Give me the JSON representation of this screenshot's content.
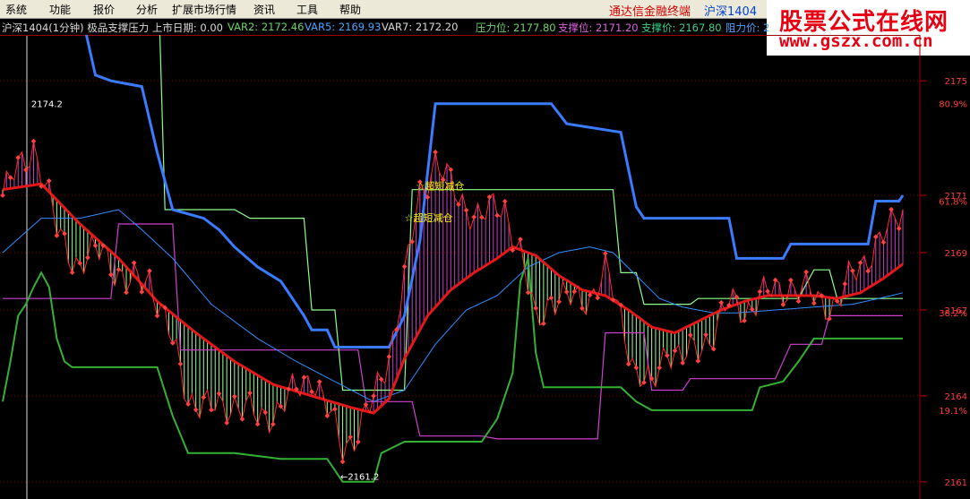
{
  "menu": [
    "系统",
    "功能",
    "报价",
    "分析",
    "扩展市场行情",
    "资讯",
    "工具",
    "帮助"
  ],
  "app_title": "通达信金融终端",
  "app_code": "沪深1404",
  "logo": {
    "line1": "股票公式在线网",
    "line2": "www.gszx.com.cn"
  },
  "info": {
    "title": "沪深1404(1分钟) 极品支撑压力 上市日期: 0.00",
    "var2": "VAR2: 2172.46",
    "var5": "VAR5: 2169.93",
    "var7": "VAR7: 2172.20",
    "pressure": "压力位: 2177.80",
    "support": "支撑位: 2171.20",
    "support_price": "支撑价: 2167.80",
    "resist_price": "阻力价: 2"
  },
  "colors": {
    "price": "#ff2a2a",
    "ma": "#e31818",
    "var5": "#2f8fff",
    "upper": "#3a7bff",
    "lower": "#35b035",
    "support": "#d040d0",
    "pressure": "#8cff8c",
    "bull_fill": "#c040c0",
    "bear_fill": "#9dff9d"
  },
  "chart_data": {
    "type": "line",
    "ylim": [
      2160.4,
      2176.6
    ],
    "y_ticks": [
      2175,
      2171,
      2169,
      2167,
      2164,
      2161
    ],
    "pct_ticks": [
      {
        "value": 2174.2,
        "label": "80.9%"
      },
      {
        "value": 2170.8,
        "label": "61.8%"
      },
      {
        "value": 2166.9,
        "label": "38.2%"
      },
      {
        "value": 2163.5,
        "label": "19.1%"
      }
    ],
    "annotations": [
      {
        "label": "2174.2",
        "x": 6,
        "y": 2174.2
      },
      {
        "label": "←2161.2",
        "x": 86,
        "y": 2161.2
      }
    ],
    "signals": [
      {
        "label": "☆超短减仓",
        "x": 107,
        "y": 2171.2
      },
      {
        "label": "☆超短减仓",
        "x": 104,
        "y": 2170.1
      }
    ],
    "n": 234,
    "series": [
      {
        "key": "close",
        "points": [
          [
            0,
            2171.0
          ],
          [
            8,
            2172.8
          ],
          [
            14,
            2169.8
          ],
          [
            20,
            2168.5
          ],
          [
            26,
            2169.2
          ],
          [
            32,
            2167.8
          ],
          [
            38,
            2168.2
          ],
          [
            44,
            2165.8
          ],
          [
            48,
            2164.0
          ],
          [
            54,
            2163.5
          ],
          [
            60,
            2163.8
          ],
          [
            66,
            2163.2
          ],
          [
            72,
            2163.6
          ],
          [
            76,
            2164.2
          ],
          [
            80,
            2164.8
          ],
          [
            84,
            2163.5
          ],
          [
            88,
            2162.2
          ],
          [
            92,
            2162.8
          ],
          [
            96,
            2163.8
          ],
          [
            100,
            2165.5
          ],
          [
            104,
            2168.0
          ],
          [
            108,
            2171.0
          ],
          [
            112,
            2172.3
          ],
          [
            118,
            2170.8
          ],
          [
            124,
            2170.3
          ],
          [
            130,
            2170.6
          ],
          [
            134,
            2169.0
          ],
          [
            138,
            2166.5
          ],
          [
            142,
            2167.5
          ],
          [
            148,
            2167.3
          ],
          [
            152,
            2167.5
          ],
          [
            156,
            2168.3
          ],
          [
            160,
            2166.8
          ],
          [
            164,
            2164.8
          ],
          [
            168,
            2164.2
          ],
          [
            172,
            2165.8
          ],
          [
            176,
            2165.3
          ],
          [
            180,
            2165.6
          ],
          [
            184,
            2166.3
          ],
          [
            188,
            2167.2
          ],
          [
            192,
            2167.0
          ],
          [
            196,
            2167.5
          ],
          [
            200,
            2167.6
          ],
          [
            204,
            2167.9
          ],
          [
            208,
            2167.6
          ],
          [
            212,
            2167.3
          ],
          [
            216,
            2167.2
          ],
          [
            220,
            2168.2
          ],
          [
            226,
            2169.3
          ],
          [
            230,
            2169.8
          ],
          [
            233,
            2170.6
          ]
        ]
      },
      {
        "key": "ma",
        "points": [
          [
            0,
            2171.2
          ],
          [
            10,
            2171.4
          ],
          [
            20,
            2170.0
          ],
          [
            30,
            2168.8
          ],
          [
            40,
            2167.3
          ],
          [
            50,
            2166.2
          ],
          [
            60,
            2165.2
          ],
          [
            70,
            2164.4
          ],
          [
            80,
            2164.0
          ],
          [
            90,
            2163.6
          ],
          [
            96,
            2163.4
          ],
          [
            100,
            2163.9
          ],
          [
            104,
            2165.3
          ],
          [
            110,
            2166.8
          ],
          [
            116,
            2167.7
          ],
          [
            122,
            2168.3
          ],
          [
            128,
            2168.8
          ],
          [
            132,
            2169.2
          ],
          [
            138,
            2168.9
          ],
          [
            144,
            2168.2
          ],
          [
            150,
            2167.7
          ],
          [
            156,
            2167.5
          ],
          [
            162,
            2167.0
          ],
          [
            168,
            2166.4
          ],
          [
            174,
            2166.2
          ],
          [
            180,
            2166.6
          ],
          [
            186,
            2167.0
          ],
          [
            192,
            2167.3
          ],
          [
            198,
            2167.5
          ],
          [
            204,
            2167.5
          ],
          [
            210,
            2167.5
          ],
          [
            216,
            2167.4
          ],
          [
            222,
            2167.6
          ],
          [
            228,
            2168.1
          ],
          [
            233,
            2168.6
          ]
        ]
      },
      {
        "key": "var5",
        "points": [
          [
            0,
            2169.0
          ],
          [
            10,
            2170.2
          ],
          [
            20,
            2170.2
          ],
          [
            30,
            2170.5
          ],
          [
            36,
            2169.8
          ],
          [
            44,
            2168.8
          ],
          [
            54,
            2167.2
          ],
          [
            66,
            2166.0
          ],
          [
            76,
            2165.2
          ],
          [
            86,
            2164.5
          ],
          [
            96,
            2163.8
          ],
          [
            104,
            2164.2
          ],
          [
            112,
            2165.8
          ],
          [
            120,
            2167.0
          ],
          [
            128,
            2167.5
          ],
          [
            136,
            2168.5
          ],
          [
            144,
            2169.0
          ],
          [
            152,
            2169.2
          ],
          [
            158,
            2169.0
          ],
          [
            164,
            2168.2
          ],
          [
            170,
            2167.4
          ],
          [
            176,
            2167.1
          ],
          [
            184,
            2166.9
          ],
          [
            190,
            2166.9
          ],
          [
            200,
            2167.0
          ],
          [
            210,
            2167.1
          ],
          [
            220,
            2167.2
          ],
          [
            230,
            2167.5
          ],
          [
            233,
            2167.6
          ]
        ]
      },
      {
        "key": "upper",
        "points": [
          [
            0,
            2179.8
          ],
          [
            16,
            2179.8
          ],
          [
            18,
            2177.8
          ],
          [
            20,
            2177.6
          ],
          [
            24,
            2175.2
          ],
          [
            28,
            2175.0
          ],
          [
            36,
            2174.8
          ],
          [
            40,
            2172.5
          ],
          [
            44,
            2170.5
          ],
          [
            52,
            2170.2
          ],
          [
            56,
            2169.8
          ],
          [
            60,
            2169.2
          ],
          [
            66,
            2168.5
          ],
          [
            72,
            2168.0
          ],
          [
            78,
            2166.8
          ],
          [
            80,
            2166.3
          ],
          [
            84,
            2166.3
          ],
          [
            86,
            2165.7
          ],
          [
            100,
            2165.7
          ],
          [
            104,
            2166.8
          ],
          [
            108,
            2169.4
          ],
          [
            112,
            2174.2
          ],
          [
            142,
            2174.2
          ],
          [
            146,
            2173.5
          ],
          [
            160,
            2173.2
          ],
          [
            164,
            2170.6
          ],
          [
            166,
            2170.2
          ],
          [
            188,
            2170.2
          ],
          [
            190,
            2168.8
          ],
          [
            202,
            2168.8
          ],
          [
            204,
            2169.3
          ],
          [
            224,
            2169.3
          ],
          [
            226,
            2170.8
          ],
          [
            232,
            2170.8
          ],
          [
            233,
            2171.0
          ]
        ]
      },
      {
        "key": "lower",
        "points": [
          [
            0,
            2163.8
          ],
          [
            2,
            2165.2
          ],
          [
            4,
            2166.8
          ],
          [
            6,
            2167.2
          ],
          [
            8,
            2167.8
          ],
          [
            10,
            2168.3
          ],
          [
            12,
            2167.8
          ],
          [
            14,
            2166.0
          ],
          [
            16,
            2165.2
          ],
          [
            18,
            2165.0
          ],
          [
            40,
            2165.0
          ],
          [
            44,
            2163.3
          ],
          [
            48,
            2162.0
          ],
          [
            56,
            2162.0
          ],
          [
            60,
            2162.0
          ],
          [
            72,
            2161.8
          ],
          [
            80,
            2161.8
          ],
          [
            84,
            2161.8
          ],
          [
            88,
            2161.0
          ],
          [
            96,
            2161.0
          ],
          [
            98,
            2162.0
          ],
          [
            104,
            2162.4
          ],
          [
            120,
            2162.4
          ],
          [
            124,
            2162.4
          ],
          [
            128,
            2163.2
          ],
          [
            132,
            2164.8
          ],
          [
            134,
            2168.0
          ],
          [
            136,
            2168.8
          ],
          [
            138,
            2165.5
          ],
          [
            140,
            2164.3
          ],
          [
            160,
            2164.3
          ],
          [
            164,
            2163.8
          ],
          [
            168,
            2163.5
          ],
          [
            194,
            2163.5
          ],
          [
            196,
            2164.3
          ],
          [
            202,
            2164.5
          ],
          [
            206,
            2165.2
          ],
          [
            210,
            2166.0
          ],
          [
            233,
            2166.0
          ]
        ]
      },
      {
        "key": "support",
        "points": [
          [
            0,
            2167.4
          ],
          [
            10,
            2167.4
          ],
          [
            20,
            2167.4
          ],
          [
            28,
            2167.4
          ],
          [
            30,
            2170.0
          ],
          [
            44,
            2170.0
          ],
          [
            46,
            2165.6
          ],
          [
            92,
            2165.6
          ],
          [
            94,
            2163.8
          ],
          [
            106,
            2163.8
          ],
          [
            108,
            2162.6
          ],
          [
            124,
            2162.6
          ],
          [
            128,
            2162.5
          ],
          [
            154,
            2162.5
          ],
          [
            156,
            2166.2
          ],
          [
            166,
            2166.2
          ],
          [
            168,
            2164.2
          ],
          [
            176,
            2164.2
          ],
          [
            178,
            2164.6
          ],
          [
            200,
            2164.6
          ],
          [
            204,
            2165.8
          ],
          [
            212,
            2165.8
          ],
          [
            214,
            2166.8
          ],
          [
            233,
            2166.8
          ]
        ]
      },
      {
        "key": "pressure",
        "points": [
          [
            0,
            2179.8
          ],
          [
            40,
            2179.8
          ],
          [
            42,
            2170.5
          ],
          [
            58,
            2170.5
          ],
          [
            60,
            2170.5
          ],
          [
            64,
            2170.2
          ],
          [
            78,
            2170.2
          ],
          [
            80,
            2167.0
          ],
          [
            86,
            2167.0
          ],
          [
            88,
            2164.2
          ],
          [
            98,
            2164.2
          ],
          [
            100,
            2164.2
          ],
          [
            104,
            2164.2
          ],
          [
            106,
            2171.2
          ],
          [
            158,
            2171.2
          ],
          [
            160,
            2168.3
          ],
          [
            164,
            2168.3
          ],
          [
            166,
            2167.2
          ],
          [
            178,
            2167.2
          ],
          [
            180,
            2167.4
          ],
          [
            206,
            2167.4
          ],
          [
            210,
            2168.4
          ],
          [
            214,
            2168.4
          ],
          [
            216,
            2167.4
          ],
          [
            233,
            2167.4
          ]
        ]
      }
    ]
  }
}
